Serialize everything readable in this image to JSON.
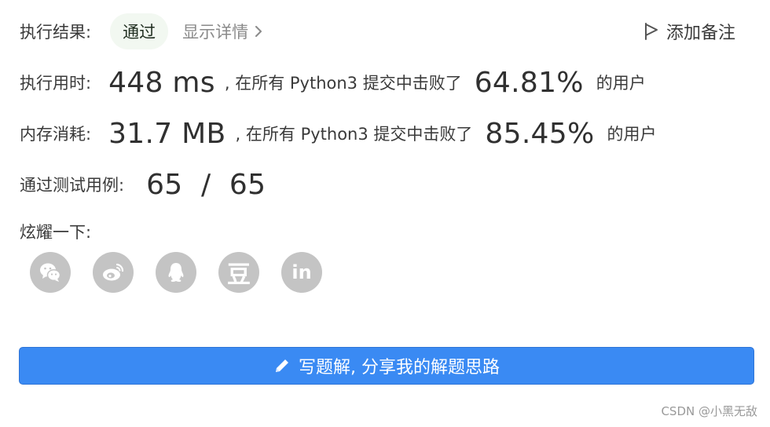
{
  "result": {
    "label": "执行结果:",
    "status": "通过",
    "details_link": "显示详情"
  },
  "add_note": {
    "label": "添加备注"
  },
  "runtime": {
    "label": "执行用时:",
    "value": "448 ms",
    "sep_text": ", 在所有 Python3 提交中击败了",
    "percent": "64.81%",
    "suffix": "的用户"
  },
  "memory": {
    "label": "内存消耗:",
    "value": "31.7 MB",
    "sep_text": ", 在所有 Python3 提交中击败了",
    "percent": "85.45%",
    "suffix": "的用户"
  },
  "tests": {
    "label": "通过测试用例:",
    "value": "65  /  65"
  },
  "share": {
    "label": "炫耀一下:",
    "icons": [
      "wechat-icon",
      "weibo-icon",
      "qq-icon",
      "douban-icon",
      "linkedin-icon"
    ],
    "douban_glyph": "豆",
    "linkedin_glyph": "in"
  },
  "write_solution": {
    "label": "写题解, 分享我的解题思路"
  },
  "watermark": "CSDN @小黑无敌",
  "colors": {
    "accent": "#3a8af3",
    "badge_bg": "#f2f8f1",
    "social_bg": "#c4c4c4"
  }
}
